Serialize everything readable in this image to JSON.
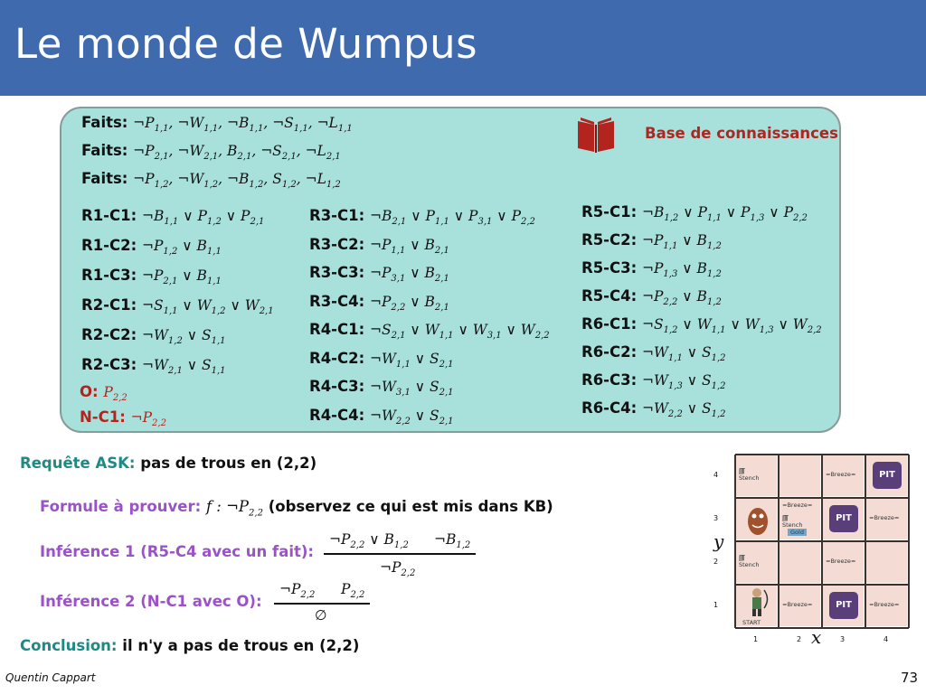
{
  "title": "Le monde de Wumpus",
  "kb_label": "Base de connaissances",
  "facts": [
    {
      "label": "Faits:",
      "items": [
        [
          "¬P",
          "1,1"
        ],
        [
          "¬W",
          "1,1"
        ],
        [
          "¬B",
          "1,1"
        ],
        [
          "¬S",
          "1,1"
        ],
        [
          "¬L",
          "1,1"
        ]
      ]
    },
    {
      "label": "Faits:",
      "items": [
        [
          "¬P",
          "2,1"
        ],
        [
          "¬W",
          "2,1"
        ],
        [
          "B",
          "2,1"
        ],
        [
          "¬S",
          "2,1"
        ],
        [
          "¬L",
          "2,1"
        ]
      ]
    },
    {
      "label": "Faits:",
      "items": [
        [
          "¬P",
          "1,2"
        ],
        [
          "¬W",
          "1,2"
        ],
        [
          "¬B",
          "1,2"
        ],
        [
          "S",
          "1,2"
        ],
        [
          "¬L",
          "1,2"
        ]
      ]
    }
  ],
  "col1": [
    {
      "label": "R1-C1:",
      "terms": [
        [
          "¬B",
          "1,1"
        ],
        [
          "P",
          "1,2"
        ],
        [
          "P",
          "2,1"
        ]
      ]
    },
    {
      "label": "R1-C2:",
      "terms": [
        [
          "¬P",
          "1,2"
        ],
        [
          "B",
          "1,1"
        ]
      ]
    },
    {
      "label": "R1-C3:",
      "terms": [
        [
          "¬P",
          "2,1"
        ],
        [
          "B",
          "1,1"
        ]
      ]
    },
    {
      "label": "R2-C1:",
      "terms": [
        [
          "¬S",
          "1,1"
        ],
        [
          "W",
          "1,2"
        ],
        [
          "W",
          "2,1"
        ]
      ]
    },
    {
      "label": "R2-C2:",
      "terms": [
        [
          "¬W",
          "1,2"
        ],
        [
          "S",
          "1,1"
        ]
      ]
    },
    {
      "label": "R2-C3:",
      "terms": [
        [
          "¬W",
          "2,1"
        ],
        [
          "S",
          "1,1"
        ]
      ]
    }
  ],
  "obs": {
    "label": "O:",
    "terms": [
      [
        "P",
        "2,2"
      ]
    ]
  },
  "neg": {
    "label": "N-C1:",
    "terms": [
      [
        "¬P",
        "2,2"
      ]
    ]
  },
  "col2": [
    {
      "label": "R3-C1:",
      "terms": [
        [
          "¬B",
          "2,1"
        ],
        [
          "P",
          "1,1"
        ],
        [
          "P",
          "3,1"
        ],
        [
          "P",
          "2,2"
        ]
      ]
    },
    {
      "label": "R3-C2:",
      "terms": [
        [
          "¬P",
          "1,1"
        ],
        [
          "B",
          "2,1"
        ]
      ]
    },
    {
      "label": "R3-C3:",
      "terms": [
        [
          "¬P",
          "3,1"
        ],
        [
          "B",
          "2,1"
        ]
      ]
    },
    {
      "label": "R3-C4:",
      "terms": [
        [
          "¬P",
          "2,2"
        ],
        [
          "B",
          "2,1"
        ]
      ]
    },
    {
      "label": "R4-C1:",
      "terms": [
        [
          "¬S",
          "2,1"
        ],
        [
          "W",
          "1,1"
        ],
        [
          "W",
          "3,1"
        ],
        [
          "W",
          "2,2"
        ]
      ]
    },
    {
      "label": "R4-C2:",
      "terms": [
        [
          "¬W",
          "1,1"
        ],
        [
          "S",
          "2,1"
        ]
      ]
    },
    {
      "label": "R4-C3:",
      "terms": [
        [
          "¬W",
          "3,1"
        ],
        [
          "S",
          "2,1"
        ]
      ]
    },
    {
      "label": "R4-C4:",
      "terms": [
        [
          "¬W",
          "2,2"
        ],
        [
          "S",
          "2,1"
        ]
      ]
    }
  ],
  "col3": [
    {
      "label": "R5-C1:",
      "terms": [
        [
          "¬B",
          "1,2"
        ],
        [
          "P",
          "1,1"
        ],
        [
          "P",
          "1,3"
        ],
        [
          "P",
          "2,2"
        ]
      ]
    },
    {
      "label": "R5-C2:",
      "terms": [
        [
          "¬P",
          "1,1"
        ],
        [
          "B",
          "1,2"
        ]
      ]
    },
    {
      "label": "R5-C3:",
      "terms": [
        [
          "¬P",
          "1,3"
        ],
        [
          "B",
          "1,2"
        ]
      ]
    },
    {
      "label": "R5-C4:",
      "terms": [
        [
          "¬P",
          "2,2"
        ],
        [
          "B",
          "1,2"
        ]
      ]
    },
    {
      "label": "R6-C1:",
      "terms": [
        [
          "¬S",
          "1,2"
        ],
        [
          "W",
          "1,1"
        ],
        [
          "W",
          "1,3"
        ],
        [
          "W",
          "2,2"
        ]
      ]
    },
    {
      "label": "R6-C2:",
      "terms": [
        [
          "¬W",
          "1,1"
        ],
        [
          "S",
          "1,2"
        ]
      ]
    },
    {
      "label": "R6-C3:",
      "terms": [
        [
          "¬W",
          "1,3"
        ],
        [
          "S",
          "1,2"
        ]
      ]
    },
    {
      "label": "R6-C4:",
      "terms": [
        [
          "¬W",
          "2,2"
        ],
        [
          "S",
          "1,2"
        ]
      ]
    }
  ],
  "query": {
    "label": "Requête ASK:",
    "text": "pas de trous en (2,2)"
  },
  "formula": {
    "label": "Formule à prouver:",
    "math": "f : ¬P",
    "sub": "2,2",
    "text": "(observez ce qui est mis dans KB)"
  },
  "inf1": {
    "label": "Inférence 1 (R5-C4 avec un fait):",
    "premise_a": "¬P",
    "premise_a_sub": "2,2",
    "premise_a_rest": " ∨ B",
    "premise_a_rest_sub": "1,2",
    "premise_b": "¬B",
    "premise_b_sub": "1,2",
    "conclusion": "¬P",
    "conclusion_sub": "2,2"
  },
  "inf2": {
    "label": "Inférence 2 (N-C1 avec O):",
    "premise_a": "¬P",
    "premise_a_sub": "2,2",
    "premise_b": "P",
    "premise_b_sub": "2,2",
    "conclusion": "∅"
  },
  "conclusion": {
    "label": "Conclusion:",
    "text": "il n'y a pas de trous en (2,2)"
  },
  "grid": {
    "pit_label": "PIT",
    "stench": "Stench",
    "breeze": "Breeze",
    "gold": "Gold",
    "start": "START",
    "x_ticks": [
      "1",
      "2",
      "3",
      "4"
    ],
    "y_ticks": [
      "1",
      "2",
      "3",
      "4"
    ],
    "x_label": "x",
    "y_label": "y"
  },
  "footer": {
    "author": "Quentin Cappart",
    "page": "73"
  }
}
